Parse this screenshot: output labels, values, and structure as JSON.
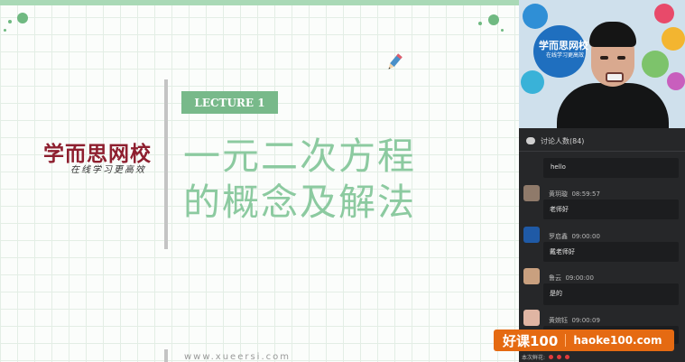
{
  "slide": {
    "lecture_label": "LECTURE 1",
    "title_line1": "一元二次方程",
    "title_line2": "的概念及解法",
    "logo_main": "学而思网校",
    "logo_sub": "在线学习更高效",
    "website": "www.xueersi.com"
  },
  "video": {
    "logo_main": "学而思网校",
    "logo_sub": "在线学习更高效"
  },
  "chat": {
    "header": "讨论人数(84)",
    "first_message": "hello",
    "messages": [
      {
        "user": "黄玥璇",
        "time": "08:59:57",
        "text": "老师好"
      },
      {
        "user": "罗启鑫",
        "time": "09:00:00",
        "text": "戴老师好"
      },
      {
        "user": "鲁云",
        "time": "09:00:00",
        "text": "是的"
      },
      {
        "user": "黄婉钰",
        "time": "09:00:09",
        "text": ""
      }
    ]
  },
  "watermark": {
    "left": "好课100",
    "right": "haoke100.com"
  },
  "footer": {
    "label": "本次鲜花:"
  },
  "colors": {
    "accent_green": "#78b98a",
    "title_green": "#8ccaa0",
    "logo_red": "#8e1f2f",
    "panel_bg": "#262729",
    "watermark_orange": "#e56a12"
  }
}
